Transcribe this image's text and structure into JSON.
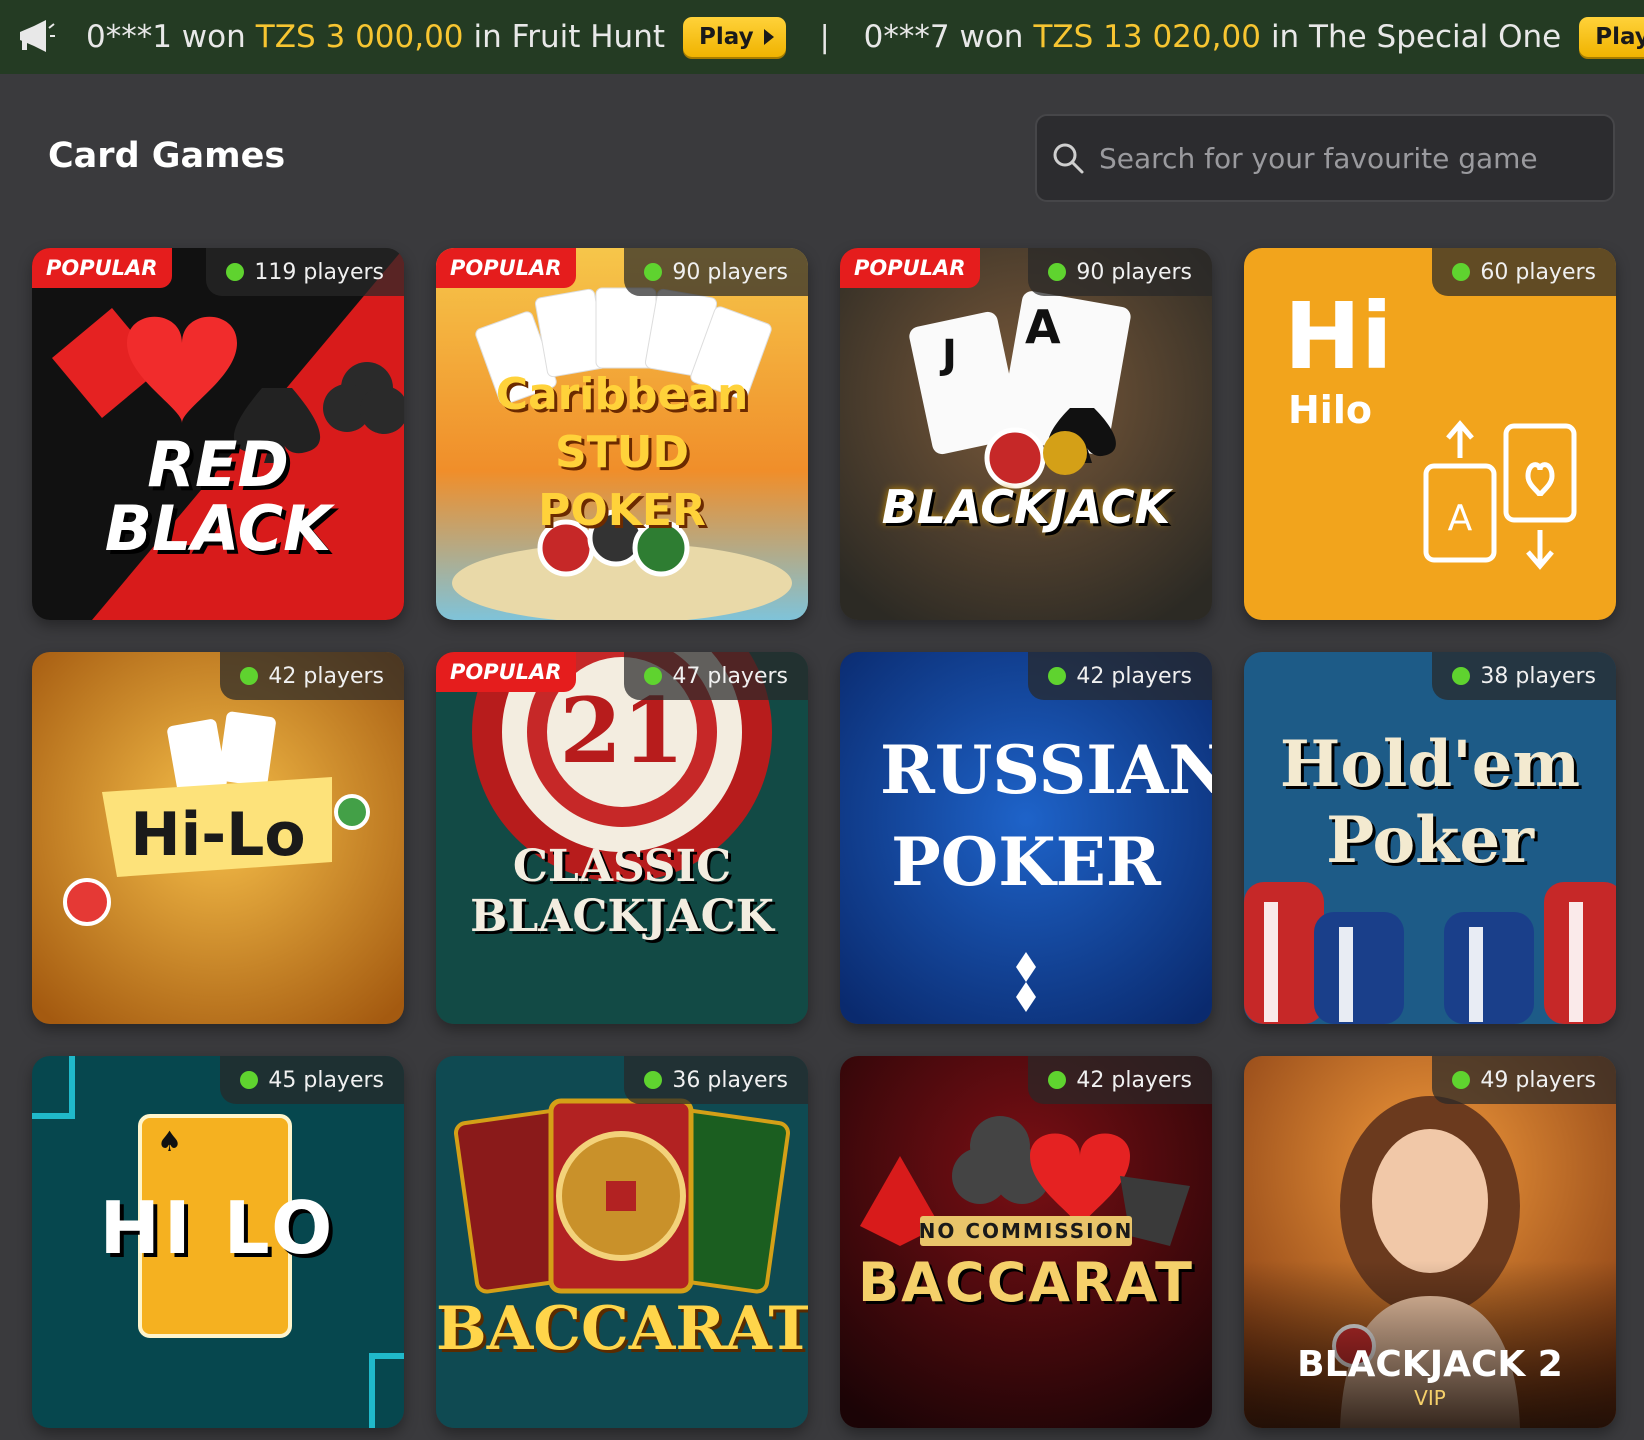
{
  "ticker": {
    "items": [
      {
        "user": "0***1 won",
        "amount": "TZS 3 000,00",
        "game": "in Fruit Hunt",
        "play": "Play"
      },
      {
        "user": "0***7 won",
        "amount": "TZS 13 020,00",
        "game": "in The Special One",
        "play": "Play"
      }
    ],
    "separator": "|"
  },
  "header": {
    "title": "Card Games",
    "search_placeholder": "Search for your favourite game"
  },
  "games": [
    {
      "label": "RED BLACK",
      "players": "119 players",
      "badge": "POPULAR"
    },
    {
      "label": "Caribbean STUD POKER",
      "players": "90 players",
      "badge": "POPULAR"
    },
    {
      "label": "BLACKJACK",
      "players": "90 players",
      "badge": "POPULAR"
    },
    {
      "label": "Hi",
      "sublabel": "Hilo",
      "players": "60 players",
      "badge": ""
    },
    {
      "label": "Hi-Lo",
      "players": "42 players",
      "badge": ""
    },
    {
      "label": "CLASSIC BLACKJACK",
      "players": "47 players",
      "badge": "POPULAR"
    },
    {
      "label": "RUSSIAN POKER",
      "players": "42 players",
      "badge": ""
    },
    {
      "label": "Hold'em Poker",
      "players": "38 players",
      "badge": ""
    },
    {
      "label": "HI LO",
      "players": "45 players",
      "badge": ""
    },
    {
      "label": "BACCARAT",
      "players": "36 players",
      "badge": ""
    },
    {
      "label": "BACCARAT",
      "sublabel": "NO COMMISSION",
      "players": "42 players",
      "badge": ""
    },
    {
      "label": "BLACKJACK 2",
      "sublabel": "VIP",
      "players": "49 players",
      "badge": ""
    }
  ],
  "colors": {
    "background": "#3a3a3d",
    "ticker_bg": "#243b23",
    "accent_yellow": "#f7c531",
    "popular_red": "#e51d1d",
    "online_green": "#5fd32f"
  }
}
